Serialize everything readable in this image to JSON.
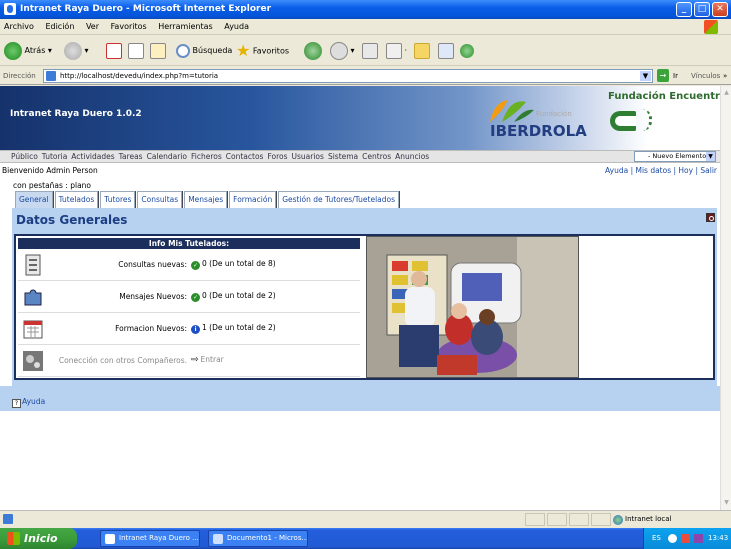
{
  "window": {
    "title": "Intranet Raya Duero - Microsoft Internet Explorer"
  },
  "menubar": [
    "Archivo",
    "Edición",
    "Ver",
    "Favoritos",
    "Herramientas",
    "Ayuda"
  ],
  "toolbar": {
    "back_label": "Atrás",
    "search_label": "Búsqueda",
    "favorites_label": "Favoritos"
  },
  "address": {
    "label": "Dirección",
    "url": "http://localhost/devedu/index.php?m=tutoria",
    "go_label": "Ir",
    "links_label": "Vínculos"
  },
  "header": {
    "app_title": "Intranet Raya Duero 1.0.2",
    "iberdrola_fund": "Fundación",
    "iberdrola_name": "IBERDROLA",
    "encuentro": "Fundación Encuentro"
  },
  "nav": {
    "items": [
      "Público",
      "Tutoria",
      "Actividades",
      "Tareas",
      "Calendario",
      "Ficheros",
      "Contactos",
      "Foros",
      "Usuarios",
      "Sistema",
      "Centros",
      "Anuncios"
    ],
    "new_element": "- Nuevo Elemento -"
  },
  "welcome": "Bienvenido Admin Person",
  "user_links": {
    "ayuda": "Ayuda",
    "misdatos": "Mis datos",
    "hoy": "Hoy",
    "salir": "Salir",
    "sep": " | "
  },
  "pestanas": "con pestañas : plano",
  "tabs": [
    "General",
    "Tutelados",
    "Tutores",
    "Consultas",
    "Mensajes",
    "Formación",
    "Gestión de Tutores/Tuetelados"
  ],
  "panel": {
    "title": "Datos Generales",
    "info_header": "Info Mis Tutelados:",
    "rows": [
      {
        "label": "Consultas nuevas:",
        "value": "0 (De un total de 8)",
        "badge": "✓",
        "badge_color": "#2a8f2a"
      },
      {
        "label": "Mensajes Nuevos:",
        "value": "0 (De un total de 2)",
        "badge": "✓",
        "badge_color": "#2a8f2a"
      },
      {
        "label": "Formacion Nuevos:",
        "value": "1 (De un total de 2)",
        "badge": "i",
        "badge_color": "#1f4fc7"
      },
      {
        "label": "Conección con otros Compañeros.",
        "value": "Entrar",
        "badge": "⇨",
        "badge_color": "#ffffff"
      }
    ]
  },
  "help": "Ayuda",
  "statusbar": {
    "zone": "Intranet local"
  },
  "taskbar": {
    "start": "Inicio",
    "tasks": [
      "Intranet Raya Duero ...",
      "Documento1 - Micros..."
    ],
    "lang": "ES",
    "time": "13:43"
  }
}
